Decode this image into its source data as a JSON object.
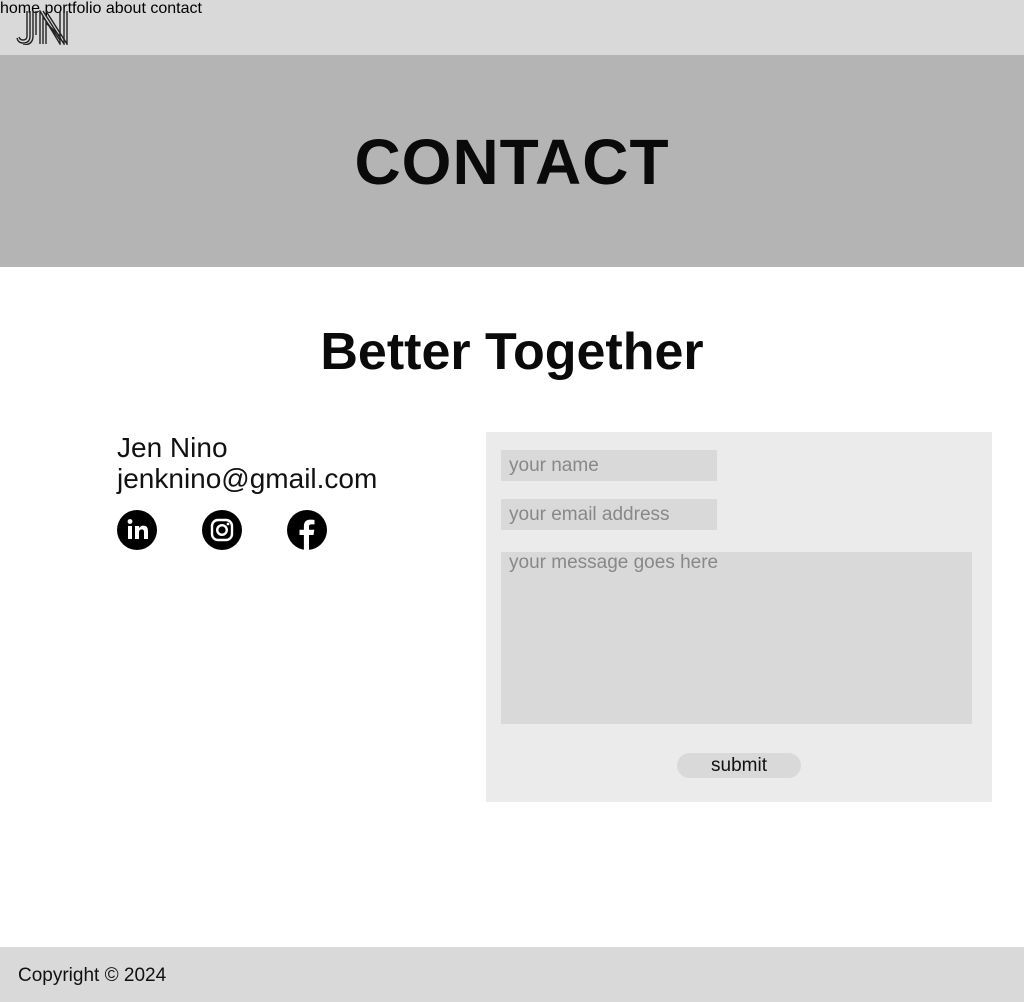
{
  "header": {
    "logo_icon": "jn-monogram-logo",
    "nav": [
      {
        "label": "home"
      },
      {
        "label": "portfolio"
      },
      {
        "label": "about"
      },
      {
        "label": "contact"
      }
    ]
  },
  "banner": {
    "title": "CONTACT"
  },
  "main": {
    "heading": "Better Together",
    "contact": {
      "name": "Jen Nino",
      "email": "jenknino@gmail.com"
    },
    "socials": [
      {
        "icon": "linkedin-icon"
      },
      {
        "icon": "instagram-icon"
      },
      {
        "icon": "facebook-icon"
      }
    ],
    "form": {
      "name_placeholder": "your name",
      "email_placeholder": "your email address",
      "message_placeholder": "your message goes here",
      "submit_label": "submit"
    }
  },
  "footer": {
    "copyright": "Copyright © 2024"
  },
  "colors": {
    "topbar": "#d9d9d9",
    "banner": "#b4b4b4",
    "form_panel": "#ebebeb",
    "field": "#d9d9d9",
    "footer": "#d9d9d9"
  }
}
